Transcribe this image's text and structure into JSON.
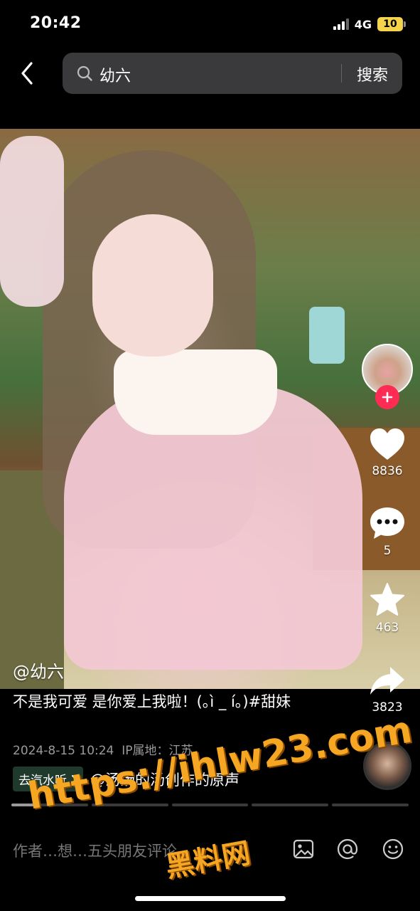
{
  "status_bar": {
    "time": "20:42",
    "network": "4G",
    "battery": "10"
  },
  "search": {
    "query": "幼六",
    "button_label": "搜索"
  },
  "video": {
    "author_handle": "@幼六",
    "description": "不是我可爱 是你爱上我啦！(｡ì _ í｡)#甜妹",
    "date": "2024-8-15 10:24",
    "ip_location": "IP属地：江苏",
    "music_chip_label": "去汽水听",
    "music_title": "@汤汤的汤创作的原声"
  },
  "actions": {
    "likes": "8836",
    "comments": "5",
    "favorites": "463",
    "shares": "3823"
  },
  "progress": {
    "segments": 5,
    "current_segment_fill": 0.35
  },
  "comment_bar": {
    "placeholder": "作者…想…五头朋友评论"
  },
  "watermark": {
    "url": "https://ihlw23.com",
    "name": "黑料网"
  },
  "colors": {
    "accent_red": "#fe2c55",
    "chip_green": "#1f3a2c",
    "watermark_orange": "#f5a623"
  }
}
